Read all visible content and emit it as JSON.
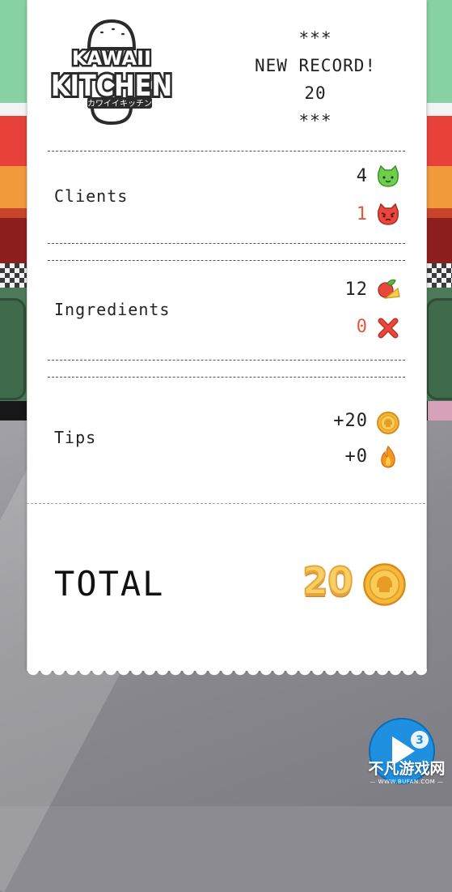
{
  "brand": {
    "logo_word_1": "KAWAII",
    "logo_word_2": "KITCHEN",
    "logo_katakana": "カワイイキッチン"
  },
  "record": {
    "stars_top": "***",
    "title": "NEW RECORD!",
    "value": "20",
    "stars_bottom": "***"
  },
  "clients": {
    "label": "Clients",
    "happy_count": "4",
    "happy_icon": "happy-cat-icon",
    "angry_count": "1",
    "angry_icon": "angry-cat-icon"
  },
  "ingredients": {
    "label": "Ingredients",
    "used_count": "12",
    "used_icon": "vegetables-icon",
    "wasted_count": "0",
    "wasted_icon": "red-x-icon"
  },
  "tips": {
    "label": "Tips",
    "coins": "+20",
    "coins_icon": "coin-icon",
    "fire": "+0",
    "fire_icon": "fire-icon"
  },
  "total": {
    "label": "TOTAL",
    "value": "20",
    "icon": "coin-icon"
  },
  "watermark": {
    "text": "不凡游戏网",
    "sub": "— WWW.BUFAN.COM —",
    "badge": "3"
  },
  "colors": {
    "negative": "#e5573d",
    "coin": "#f5b93a",
    "happy": "#6fcf4a",
    "angry": "#e8483c"
  }
}
